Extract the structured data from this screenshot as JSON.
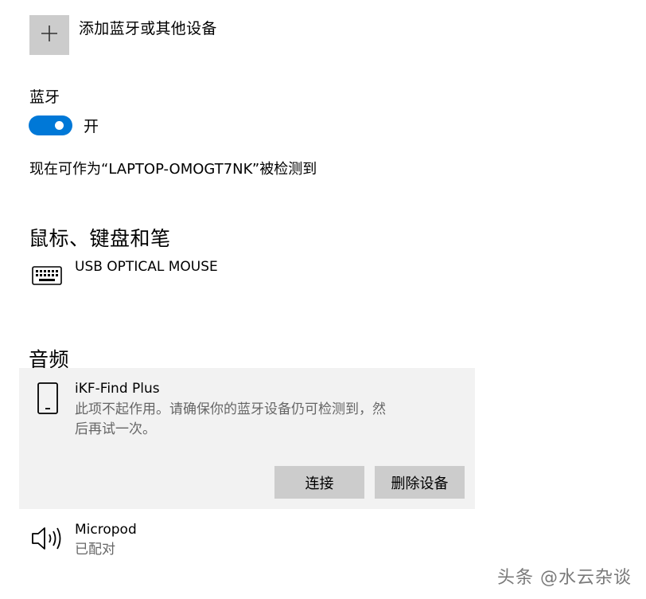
{
  "add_device": {
    "label": "添加蓝牙或其他设备",
    "icon": "plus-icon"
  },
  "bluetooth": {
    "label": "蓝牙",
    "toggle_state": "开",
    "toggle_on": true,
    "discoverable_text": "现在可作为“LAPTOP-OMOGT7NK”被检测到",
    "accent_color": "#0078d7"
  },
  "mouse_keyboard_pen": {
    "title": "鼠标、键盘和笔",
    "devices": [
      {
        "name": "USB OPTICAL MOUSE",
        "icon": "keyboard-icon"
      }
    ]
  },
  "audio": {
    "title": "音频",
    "selected_device": {
      "name": "iKF-Find Plus",
      "icon": "phone-icon",
      "status_line1": "此项不起作用。请确保你的蓝牙设备仍可检测到，然",
      "status_line2": "后再试一次。",
      "connect_label": "连接",
      "remove_label": "删除设备"
    },
    "devices": [
      {
        "name": "Micropod",
        "status": "已配对",
        "icon": "speaker-icon"
      }
    ]
  },
  "watermark": "头条 @水云杂谈"
}
